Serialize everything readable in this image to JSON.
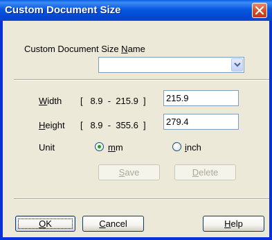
{
  "window": {
    "title": "Custom Document Size"
  },
  "name_field": {
    "label_prefix": "Custom Document Size ",
    "label_mnemonic": "N",
    "label_suffix": "ame",
    "value": ""
  },
  "width_field": {
    "label_mnemonic": "W",
    "label_suffix": "idth",
    "range": "[   8.9  -  215.9  ]",
    "value": "215.9"
  },
  "height_field": {
    "label_mnemonic": "H",
    "label_suffix": "eight",
    "range": "[   8.9  -  355.6  ]",
    "value": "279.4"
  },
  "unit": {
    "label": "Unit",
    "options": [
      {
        "mnemonic": "m",
        "rest": "m",
        "selected": true
      },
      {
        "mnemonic": "i",
        "rest": "nch",
        "selected": false
      }
    ]
  },
  "actions": {
    "save": {
      "mnemonic": "S",
      "rest": "ave"
    },
    "delete": {
      "mnemonic": "D",
      "rest": "elete"
    }
  },
  "footer": {
    "ok": {
      "mnemonic": "O",
      "rest": "K"
    },
    "cancel": {
      "mnemonic": "C",
      "rest": "ancel"
    },
    "help": {
      "mnemonic": "H",
      "rest": "elp"
    }
  }
}
